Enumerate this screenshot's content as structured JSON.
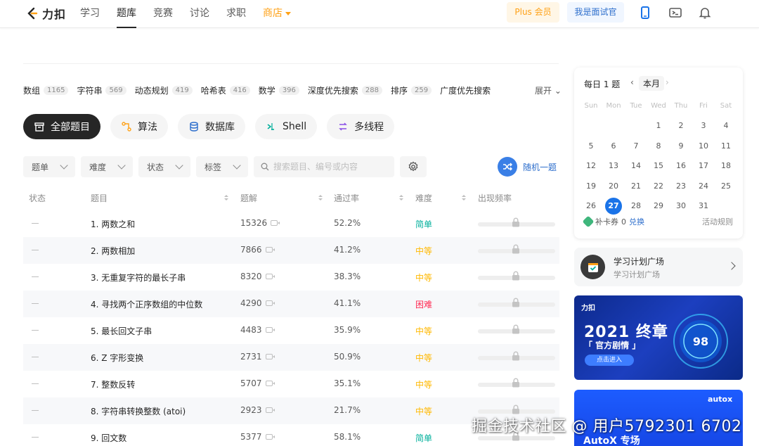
{
  "header": {
    "logo_text": "力扣",
    "nav": [
      {
        "label": "学习"
      },
      {
        "label": "题库"
      },
      {
        "label": "竞赛"
      },
      {
        "label": "讨论"
      },
      {
        "label": "求职"
      },
      {
        "label": "商店"
      }
    ],
    "plus_label": "Plus 会员",
    "interviewer_label": "我是面试官"
  },
  "tags": {
    "items": [
      {
        "label": "数组",
        "count": "1165"
      },
      {
        "label": "字符串",
        "count": "569"
      },
      {
        "label": "动态规划",
        "count": "419"
      },
      {
        "label": "哈希表",
        "count": "416"
      },
      {
        "label": "数学",
        "count": "396"
      },
      {
        "label": "深度优先搜索",
        "count": "288"
      },
      {
        "label": "排序",
        "count": "259"
      },
      {
        "label": "广度优先搜索",
        "count": ""
      }
    ],
    "expand_label": "展开"
  },
  "categories": [
    {
      "label": "全部题目",
      "icon": "all-problems-icon"
    },
    {
      "label": "算法",
      "icon": "algorithm-icon"
    },
    {
      "label": "数据库",
      "icon": "database-icon"
    },
    {
      "label": "Shell",
      "icon": "shell-icon"
    },
    {
      "label": "多线程",
      "icon": "concurrency-icon"
    }
  ],
  "filters": {
    "list_label": "题单",
    "difficulty_label": "难度",
    "status_label": "状态",
    "tags_label": "标签",
    "search_placeholder": "搜索题目、编号或内容",
    "random_label": "随机一题"
  },
  "table": {
    "headers": {
      "status": "状态",
      "title": "题目",
      "solutions": "题解",
      "acceptance": "通过率",
      "difficulty": "难度",
      "frequency": "出现频率"
    },
    "rows": [
      {
        "title": "1. 两数之和",
        "solutions": "15326",
        "acceptance": "52.2%",
        "difficulty": "简单",
        "level": "easy"
      },
      {
        "title": "2. 两数相加",
        "solutions": "7866",
        "acceptance": "41.2%",
        "difficulty": "中等",
        "level": "mid"
      },
      {
        "title": "3. 无重复字符的最长子串",
        "solutions": "8320",
        "acceptance": "38.3%",
        "difficulty": "中等",
        "level": "mid"
      },
      {
        "title": "4. 寻找两个正序数组的中位数",
        "solutions": "4290",
        "acceptance": "41.1%",
        "difficulty": "困难",
        "level": "hard"
      },
      {
        "title": "5. 最长回文子串",
        "solutions": "4483",
        "acceptance": "35.9%",
        "difficulty": "中等",
        "level": "mid"
      },
      {
        "title": "6. Z 字形变换",
        "solutions": "2731",
        "acceptance": "50.9%",
        "difficulty": "中等",
        "level": "mid"
      },
      {
        "title": "7. 整数反转",
        "solutions": "5707",
        "acceptance": "35.1%",
        "difficulty": "中等",
        "level": "mid"
      },
      {
        "title": "8. 字符串转换整数 (atoi)",
        "solutions": "2923",
        "acceptance": "21.7%",
        "difficulty": "中等",
        "level": "mid"
      },
      {
        "title": "9. 回文数",
        "solutions": "5377",
        "acceptance": "58.1%",
        "difficulty": "简单",
        "level": "easy"
      }
    ]
  },
  "calendar": {
    "title": "每日 1 题",
    "month_label": "本月",
    "weekdays": [
      "Sun",
      "Mon",
      "Tue",
      "Wed",
      "Thu",
      "Fri",
      "Sat"
    ],
    "days": [
      "",
      "",
      "",
      "1",
      "2",
      "3",
      "4",
      "5",
      "6",
      "7",
      "8",
      "9",
      "10",
      "11",
      "12",
      "13",
      "14",
      "15",
      "16",
      "17",
      "18",
      "19",
      "20",
      "21",
      "22",
      "23",
      "24",
      "25",
      "26",
      "27",
      "28",
      "29",
      "30",
      "31"
    ],
    "today": "27",
    "makeup_label": "补卡券",
    "makeup_count": "0",
    "redeem_label": "兑换",
    "rules_label": "活动规则"
  },
  "plan": {
    "title": "学习计划广场",
    "subtitle": "学习计划广场"
  },
  "banner1": {
    "logo": "力扣",
    "headline": "2021 终章",
    "subhead": "「 官方剧情 」",
    "button": "点击进入",
    "percent": "98"
  },
  "banner2": {
    "brand": "autox",
    "title": "AutoX 专场"
  },
  "watermark": "掘金技术社区 @ 用户5792301 6702",
  "colors": {
    "accent_orange": "#ffa116",
    "easy": "#00af9b",
    "medium": "#ffb800",
    "hard": "#ff2d55",
    "link_blue": "#2d6ecc"
  }
}
